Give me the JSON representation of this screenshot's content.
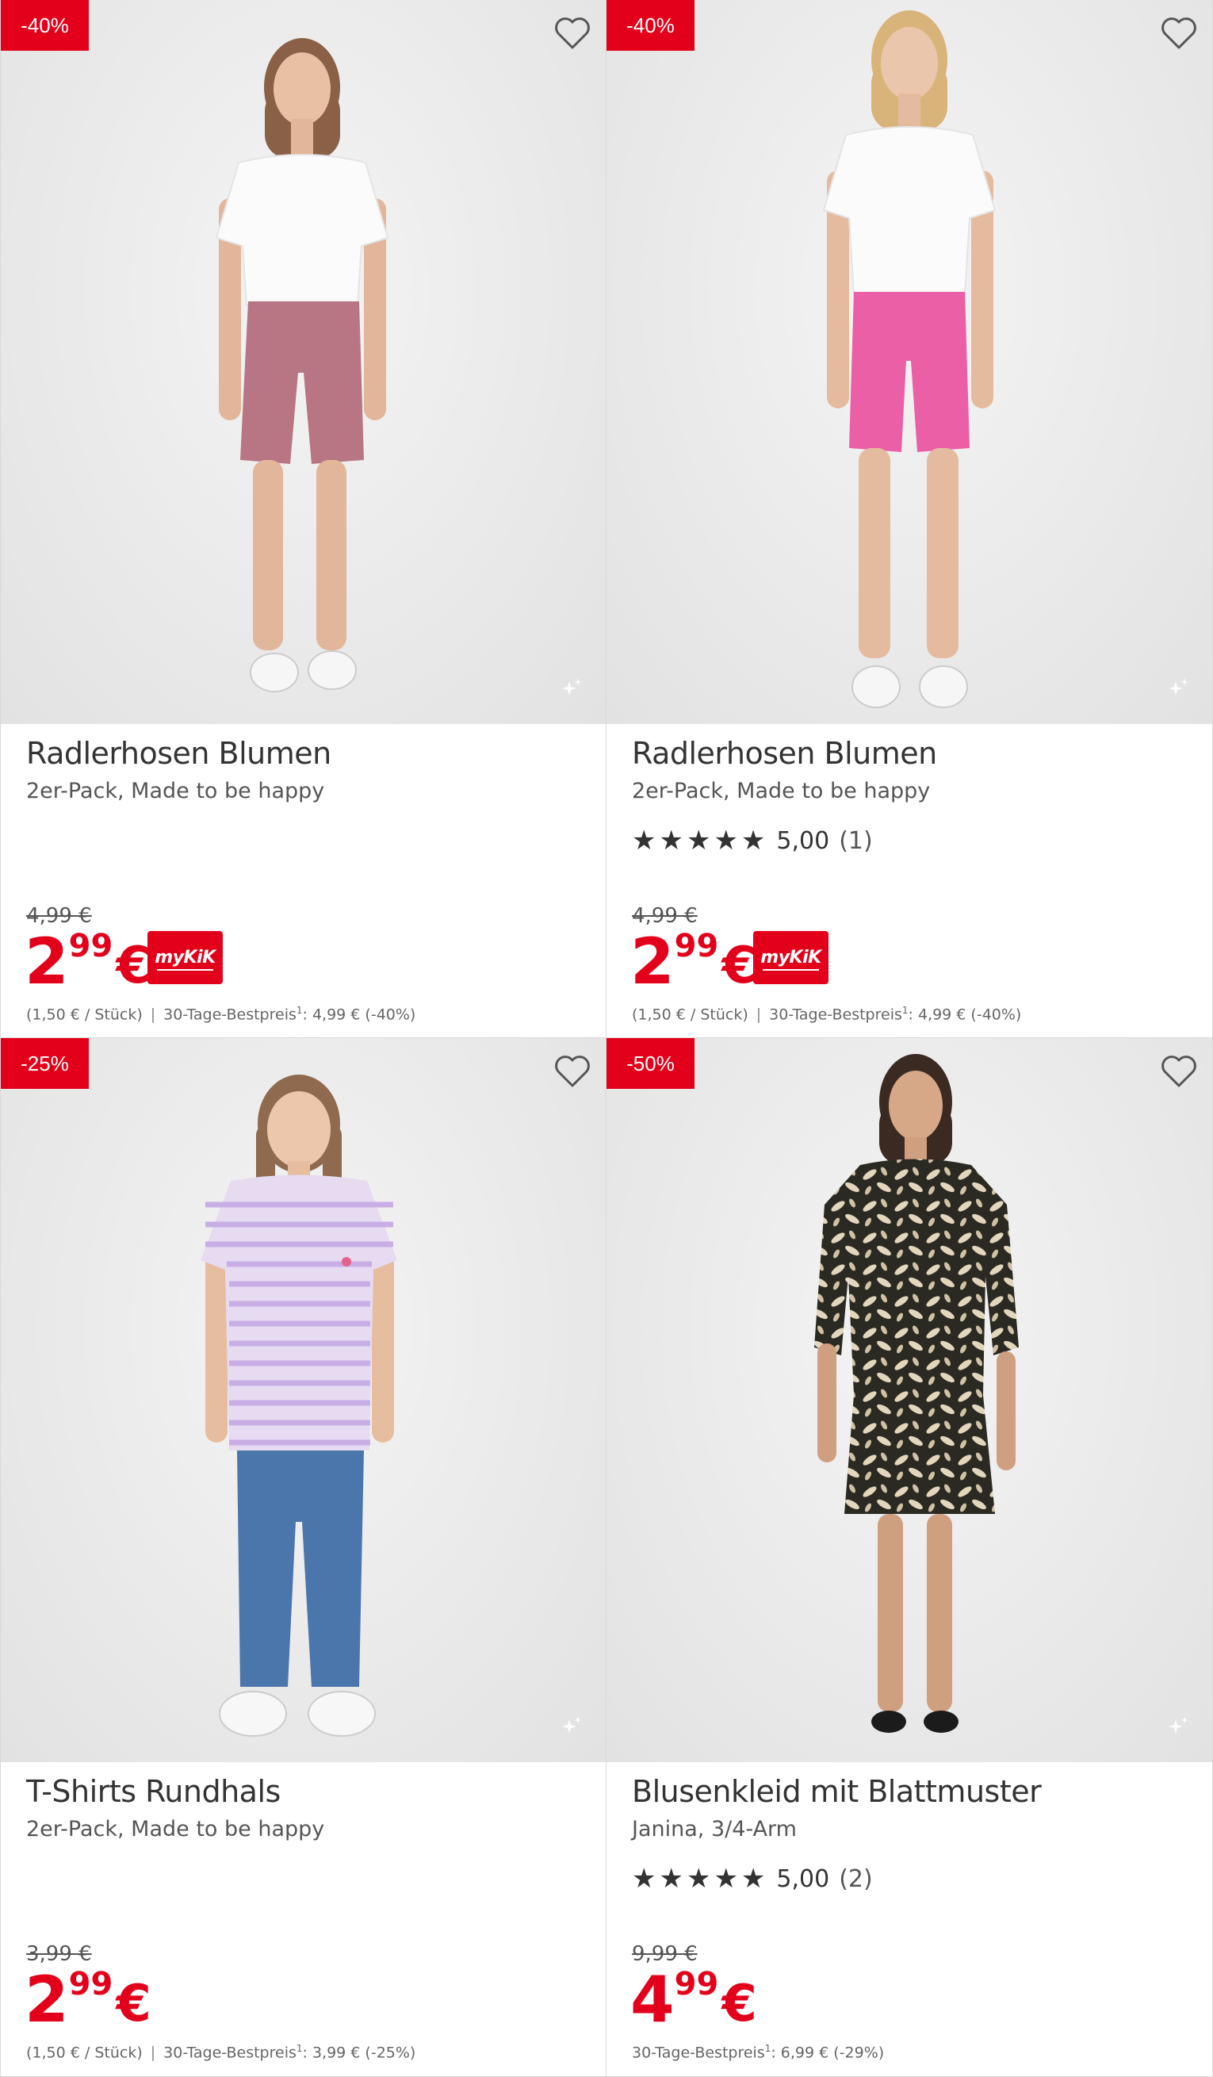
{
  "products": [
    {
      "discount": "-40%",
      "title": "Radlerhosen Blumen",
      "subtitle": "2er-Pack, Made to be happy",
      "has_rating": false,
      "old_price": "4,99 €",
      "price_int": "2",
      "price_dec": "99",
      "currency": "€",
      "mykik_label": "myKiK",
      "has_mykik": true,
      "unit_price": "(1,50 € / Stück)",
      "best_price_label": "30-Tage-Bestpreis",
      "best_price_sup": "1",
      "best_price_value": ": 4,99 € (-40%)",
      "shorts_color": "#b87583"
    },
    {
      "discount": "-40%",
      "title": "Radlerhosen Blumen",
      "subtitle": "2er-Pack, Made to be happy",
      "has_rating": true,
      "stars": "★★★★★",
      "rating": "5,00",
      "rating_count": "(1)",
      "old_price": "4,99 €",
      "price_int": "2",
      "price_dec": "99",
      "currency": "€",
      "mykik_label": "myKiK",
      "has_mykik": true,
      "unit_price": "(1,50 € / Stück)",
      "best_price_label": "30-Tage-Bestpreis",
      "best_price_sup": "1",
      "best_price_value": ": 4,99 € (-40%)",
      "shorts_color": "#ea5fa6"
    },
    {
      "discount": "-25%",
      "title": "T-Shirts Rundhals",
      "subtitle": "2er-Pack, Made to be happy",
      "has_rating": false,
      "old_price": "3,99 €",
      "price_int": "2",
      "price_dec": "99",
      "currency": "€",
      "has_mykik": false,
      "unit_price": "(1,50 € / Stück)",
      "best_price_label": "30-Tage-Bestpreis",
      "best_price_sup": "1",
      "best_price_value": ": 3,99 € (-25%)"
    },
    {
      "discount": "-50%",
      "title": "Blusenkleid mit Blattmuster",
      "subtitle": "Janina, 3/4-Arm",
      "has_rating": true,
      "stars": "★★★★★",
      "rating": "5,00",
      "rating_count": "(2)",
      "old_price": "9,99 €",
      "price_int": "4",
      "price_dec": "99",
      "currency": "€",
      "has_mykik": false,
      "unit_price": "",
      "best_price_label": "30-Tage-Bestpreis",
      "best_price_sup": "1",
      "best_price_value": ": 6,99 € (-29%)"
    }
  ],
  "colors": {
    "brand_red": "#e2001a",
    "text_dark": "#333333",
    "text_muted": "#666666"
  },
  "icons": {
    "favorite": "heart-outline-icon",
    "ai_image": "sparkle-icon"
  }
}
